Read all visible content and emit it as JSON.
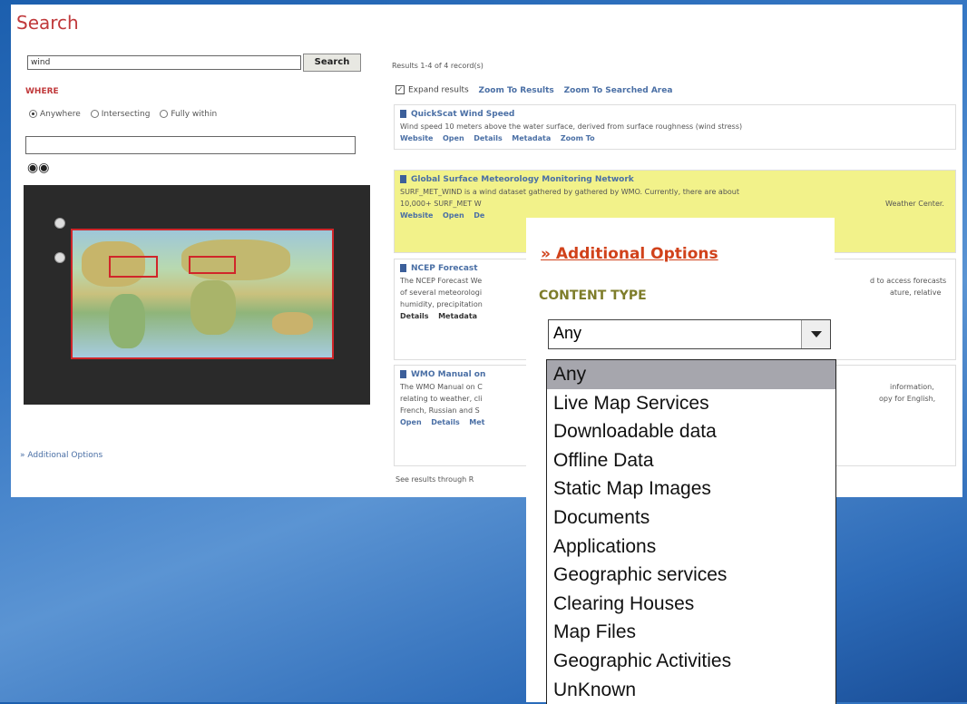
{
  "search": {
    "title": "Search",
    "query": "wind",
    "button_label": "Search",
    "where_label": "WHERE",
    "where_options": [
      "Anywhere",
      "Intersecting",
      "Fully within"
    ],
    "where_selected": "Anywhere",
    "additional_options_link": "» Additional Options"
  },
  "results": {
    "count_text": "Results 1-4 of 4 record(s)",
    "expand_label": "Expand results",
    "zoom_to_results": "Zoom To Results",
    "zoom_to_searched_area": "Zoom To Searched Area",
    "items": [
      {
        "title": "QuickScat Wind Speed",
        "description": "Wind speed 10 meters above the water surface, derived from surface roughness (wind stress)",
        "links": [
          "Website",
          "Open",
          "Details",
          "Metadata",
          "Zoom To"
        ]
      },
      {
        "title": "Global Surface Meteorology Monitoring Network",
        "description": "SURF_MET_WIND is a wind dataset gathered by gathered by WMO. Currently, there are about",
        "description2": "10,000+ SURF_MET W",
        "description2_tail": "Weather Center.",
        "links": [
          "Website",
          "Open",
          "De"
        ]
      },
      {
        "title": "NCEP Forecast",
        "description": "The NCEP Forecast We",
        "description_tail": "d to access forecasts",
        "description2": "of several meteorologi",
        "description2_tail": "ature, relative",
        "description3": "humidity, precipitation",
        "links": [
          "Details",
          "Metadata"
        ]
      },
      {
        "title": "WMO Manual on",
        "description": "The WMO Manual on C",
        "description_tail": "information,",
        "description2": "relating to weather, cli",
        "description2_tail": "opy for English,",
        "description3": "French, Russian and S",
        "links": [
          "Open",
          "Details",
          "Met"
        ]
      }
    ],
    "see_results": "See results through R"
  },
  "popup": {
    "title": "» Additional Options",
    "content_type_label": "CONTENT TYPE",
    "selected_value": "Any",
    "options": [
      "Any",
      "Live Map Services",
      "Downloadable data",
      "Offline Data",
      "Static Map Images",
      "Documents",
      "Applications",
      "Geographic services",
      "Clearing Houses",
      "Map Files",
      "Geographic Activities",
      "UnKnown"
    ]
  },
  "colors": {
    "accent_red": "#c0393b",
    "link_blue": "#4a6fa5",
    "popup_orange": "#d1421b",
    "olive": "#7e7d2a",
    "highlight_yellow": "#f2f28a",
    "background_blue": "#2d6bb8"
  }
}
